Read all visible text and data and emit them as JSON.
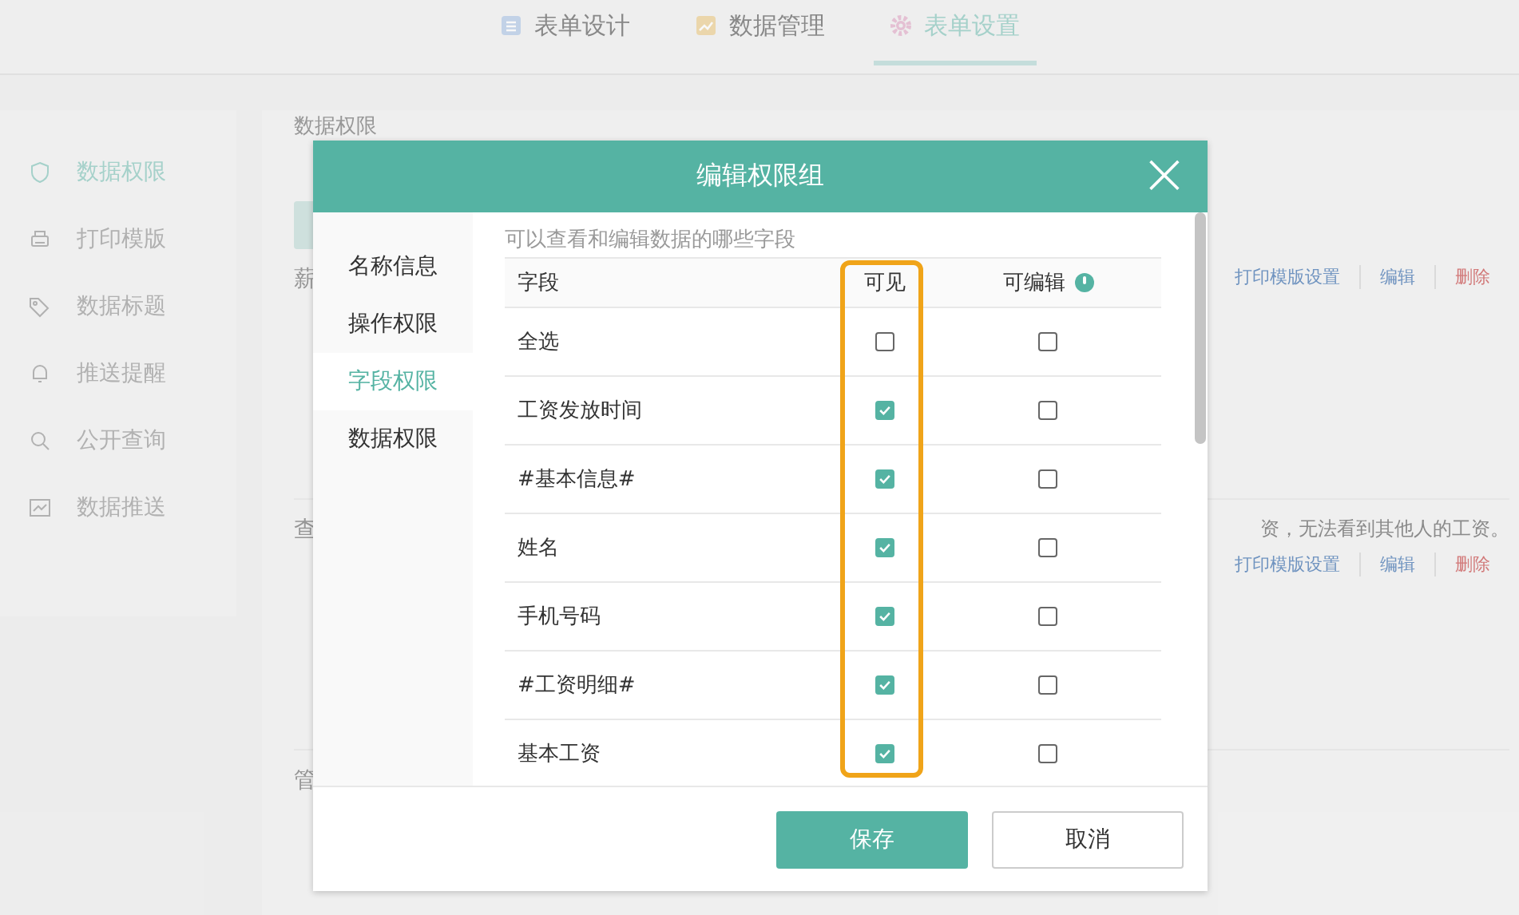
{
  "top_tabs": [
    {
      "label": "表单设计",
      "selected": false
    },
    {
      "label": "数据管理",
      "selected": false
    },
    {
      "label": "表单设置",
      "selected": true
    }
  ],
  "sidebar": {
    "items": [
      {
        "label": "数据权限",
        "selected": true
      },
      {
        "label": "打印模版",
        "selected": false
      },
      {
        "label": "数据标题",
        "selected": false
      },
      {
        "label": "推送提醒",
        "selected": false
      },
      {
        "label": "公开查询",
        "selected": false
      },
      {
        "label": "数据推送",
        "selected": false
      }
    ]
  },
  "background": {
    "title": "数据权限",
    "groups": [
      {
        "name": "薪",
        "actions": [
          "打印模版设置",
          "编辑",
          "删除"
        ]
      },
      {
        "name": "查",
        "note": "资，无法看到其他人的工资。",
        "actions": [
          "打印模版设置",
          "编辑",
          "删除"
        ]
      },
      {
        "name": "管"
      }
    ]
  },
  "dialog": {
    "title": "编辑权限组",
    "close": "×",
    "nav": [
      {
        "label": "名称信息",
        "selected": false
      },
      {
        "label": "操作权限",
        "selected": false
      },
      {
        "label": "字段权限",
        "selected": true
      },
      {
        "label": "数据权限",
        "selected": false
      }
    ],
    "subtitle": "可以查看和编辑数据的哪些字段",
    "columns": [
      "字段",
      "可见",
      "可编辑"
    ],
    "rows": [
      {
        "field": "全选",
        "visible": false,
        "editable": false
      },
      {
        "field": "工资发放时间",
        "visible": true,
        "editable": false
      },
      {
        "field": "#基本信息#",
        "visible": true,
        "editable": false
      },
      {
        "field": "姓名",
        "visible": true,
        "editable": false
      },
      {
        "field": "手机号码",
        "visible": true,
        "editable": false
      },
      {
        "field": "#工资明细#",
        "visible": true,
        "editable": false
      },
      {
        "field": "基本工资",
        "visible": true,
        "editable": false
      }
    ],
    "buttons": [
      {
        "label": "保存",
        "kind": "primary"
      },
      {
        "label": "取消",
        "kind": "secondary"
      }
    ]
  }
}
